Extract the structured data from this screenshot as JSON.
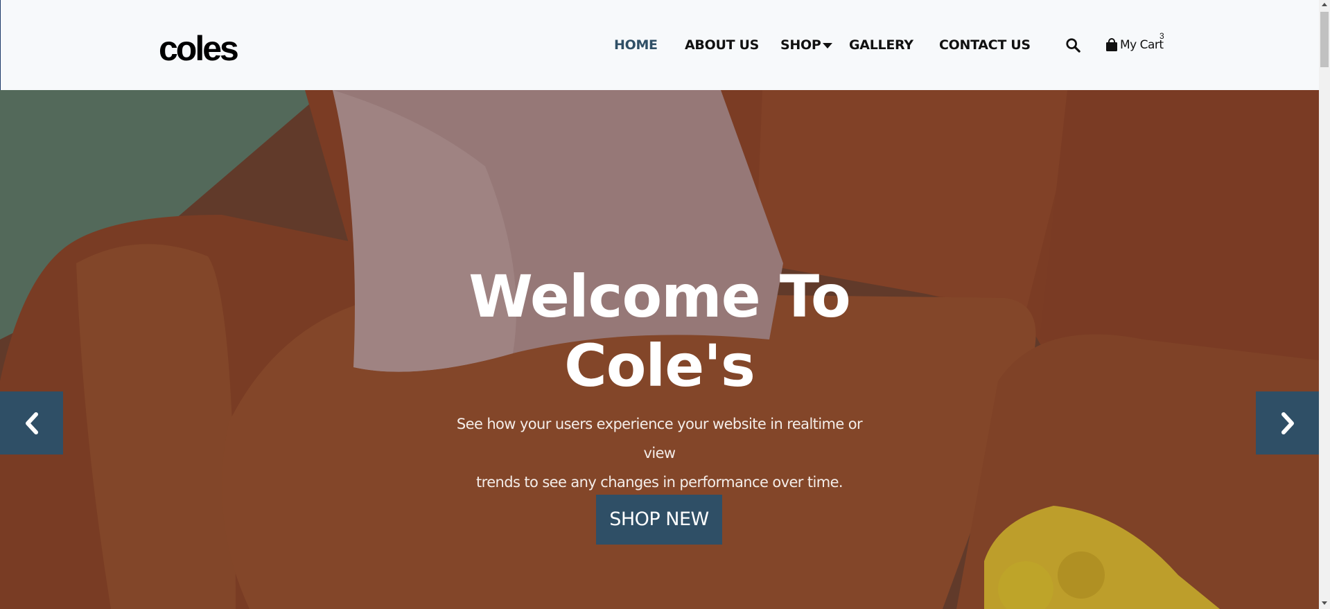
{
  "brand": {
    "logo_text": "coles"
  },
  "nav": {
    "items": [
      {
        "label": "HOME",
        "active": true
      },
      {
        "label": "ABOUT US",
        "active": false
      },
      {
        "label": "SHOP",
        "active": false,
        "has_dropdown": true
      },
      {
        "label": "GALLERY",
        "active": false
      },
      {
        "label": "CONTACT US",
        "active": false
      }
    ],
    "search_icon": "search-icon",
    "cart": {
      "label": "My Cart",
      "count": "3",
      "icon": "shopping-bag-icon"
    }
  },
  "hero": {
    "title_line1": "Welcome To",
    "title_line2": "Cole's",
    "subtitle_line1": "See how your users experience your website in realtime or view",
    "subtitle_line2": "trends to see any changes in performance over time.",
    "button_label": "SHOP NEW",
    "prev_icon": "chevron-left-icon",
    "next_icon": "chevron-right-icon"
  },
  "colors": {
    "accent": "#2f4f66",
    "header_bg": "#f7f9fb",
    "sofa": "#8a4428",
    "wall": "#5f7867"
  }
}
